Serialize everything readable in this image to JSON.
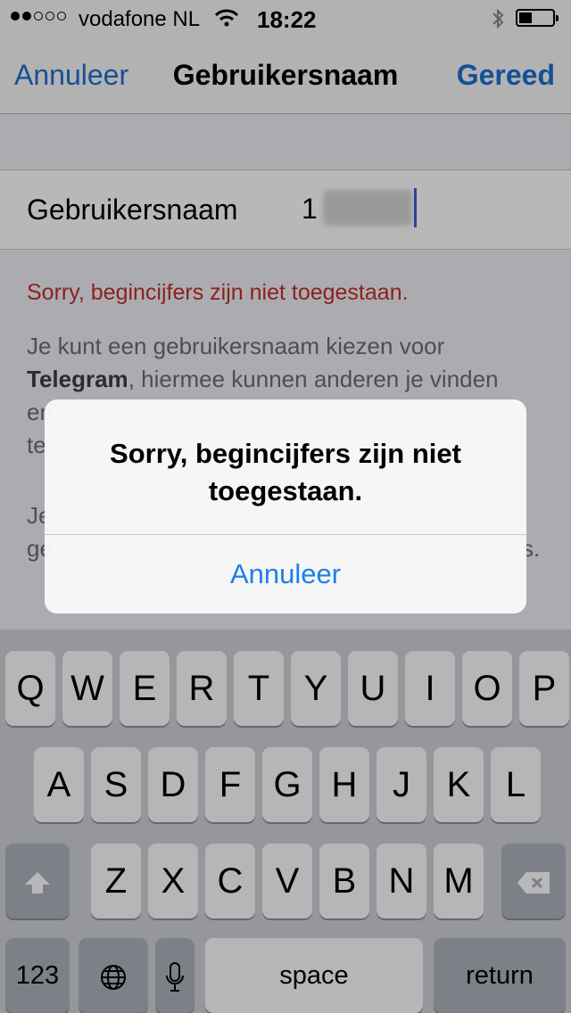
{
  "status_bar": {
    "carrier": "vodafone NL",
    "time": "18:22",
    "signal_bars_filled": 2,
    "signal_bars_total": 5,
    "battery_level": 0.3
  },
  "navbar": {
    "cancel_label": "Annuleer",
    "title": "Gebruikersnaam",
    "done_label": "Gereed"
  },
  "form": {
    "username_label": "Gebruikersnaam",
    "username_value": "1"
  },
  "error_message": "Sorry, begincijfers zijn niet toegestaan.",
  "hint": {
    "line1": "Je kunt een gebruikersnaam kiezen voor",
    "brand": "Telegram",
    "line2": ", hiermee kunnen anderen je vinden",
    "line3": "en",
    "line4": "te",
    "para2_line1": "Je",
    "para2_line2": "ge",
    "para2_end": "s."
  },
  "alert": {
    "message": "Sorry, begincijfers zijn niet toegestaan.",
    "button_label": "Annuleer"
  },
  "keyboard": {
    "row1": [
      "Q",
      "W",
      "E",
      "R",
      "T",
      "Y",
      "U",
      "I",
      "O",
      "P"
    ],
    "row2": [
      "A",
      "S",
      "D",
      "F",
      "G",
      "H",
      "J",
      "K",
      "L"
    ],
    "row3": [
      "Z",
      "X",
      "C",
      "V",
      "B",
      "N",
      "M"
    ],
    "numbers_label": "123",
    "space_label": "space",
    "return_label": "return"
  },
  "colors": {
    "accent": "#1e6fd2",
    "error": "#c0302b",
    "alert_button": "#1e7fe9"
  },
  "icons": [
    "wifi-icon",
    "bluetooth-icon",
    "battery-icon",
    "shift-icon",
    "globe-icon",
    "microphone-icon",
    "backspace-icon"
  ]
}
